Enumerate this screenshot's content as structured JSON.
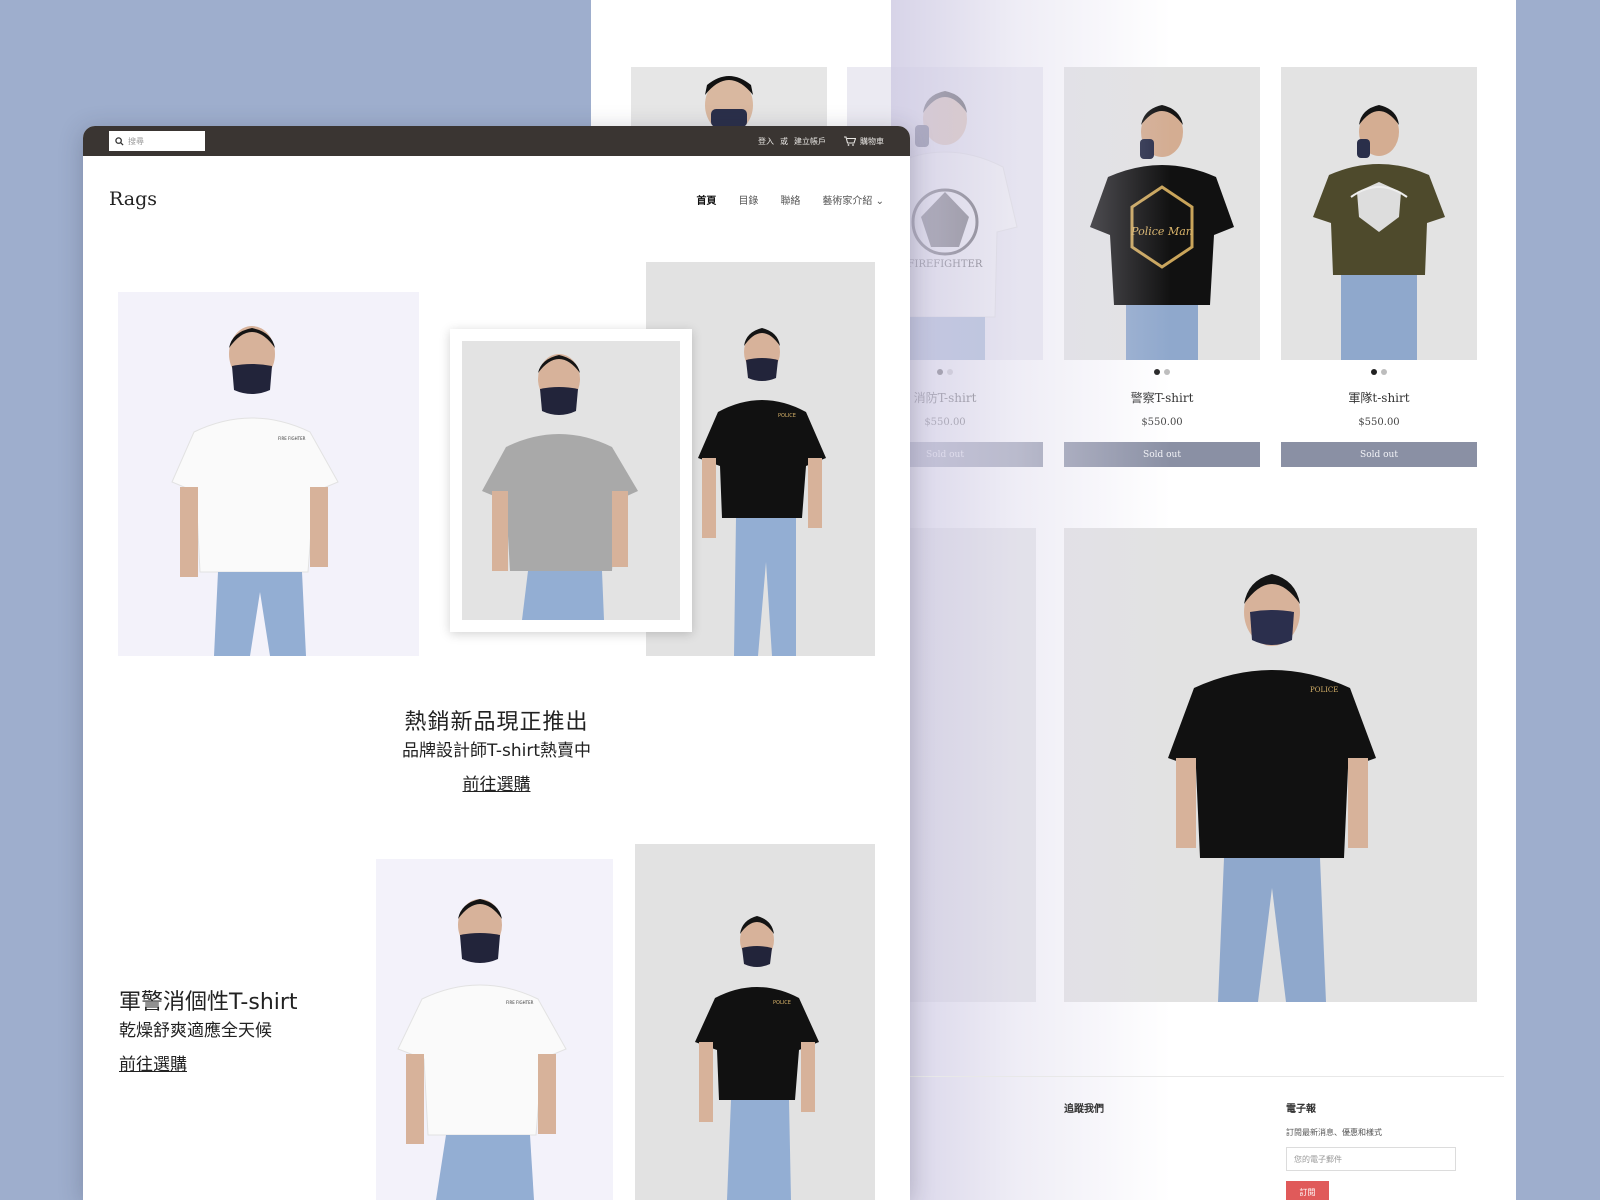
{
  "colors": {
    "background": "#9eaecd",
    "topbar": "#3a3532",
    "sold_out_button": "#8a90a4",
    "subscribe_button": "#e05a5a"
  },
  "front": {
    "search": {
      "placeholder": "搜尋"
    },
    "top_links": {
      "login": "登入",
      "or": "或",
      "create_account": "建立帳戶",
      "cart": "購物車"
    },
    "logo": "Rags",
    "nav": [
      "首頁",
      "目錄",
      "聯絡",
      "藝術家介紹"
    ],
    "hero": {
      "title": "熱銷新品現正推出",
      "subtitle": "品牌設計師T-shirt熱賣中",
      "link": "前往選購"
    },
    "section2": {
      "title": "軍警消個性T-shirt",
      "subtitle": "乾燥舒爽適應全天候",
      "link": "前往選購"
    }
  },
  "back": {
    "products": [
      {
        "name": "消防T-shirt",
        "price": "$550.00",
        "button": "Sold out"
      },
      {
        "name": "警察T-shirt",
        "price": "$550.00",
        "button": "Sold out"
      },
      {
        "name": "軍隊t-shirt",
        "price": "$550.00",
        "button": "Sold out"
      }
    ],
    "footer": {
      "follow_title": "追蹤我們",
      "newsletter_title": "電子報",
      "newsletter_desc": "訂閱最新消息、優惠和樣式",
      "email_placeholder": "您的電子郵件",
      "subscribe": "訂閱"
    }
  }
}
